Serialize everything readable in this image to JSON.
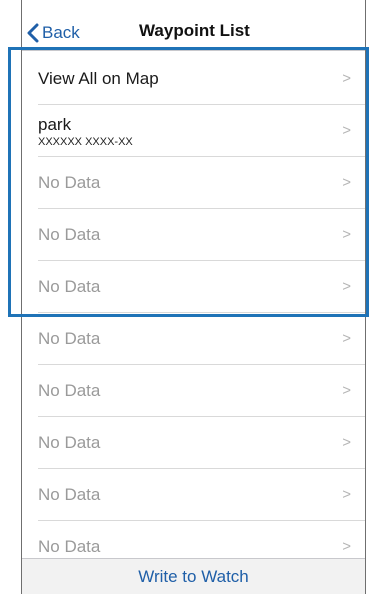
{
  "navbar": {
    "back_label": "Back",
    "title": "Waypoint List"
  },
  "rows": [
    {
      "label": "View All on Map",
      "sub": "",
      "muted": false
    },
    {
      "label": "park",
      "sub": "XXXXXX XXXX-XX",
      "muted": false
    },
    {
      "label": "No Data",
      "sub": "",
      "muted": true
    },
    {
      "label": "No Data",
      "sub": "",
      "muted": true
    },
    {
      "label": "No Data",
      "sub": "",
      "muted": true
    },
    {
      "label": "No Data",
      "sub": "",
      "muted": true
    },
    {
      "label": "No Data",
      "sub": "",
      "muted": true
    },
    {
      "label": "No Data",
      "sub": "",
      "muted": true
    },
    {
      "label": "No Data",
      "sub": "",
      "muted": true
    },
    {
      "label": "No Data",
      "sub": "",
      "muted": true
    }
  ],
  "footer": {
    "button_label": "Write to Watch"
  },
  "colors": {
    "accent": "#1f5fa8",
    "highlight": "#1f73b7",
    "muted_text": "#9a9a9a"
  }
}
